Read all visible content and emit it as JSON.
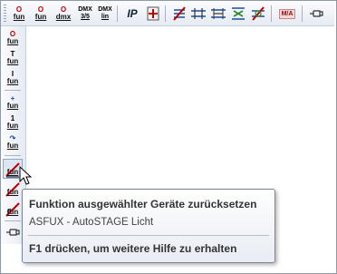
{
  "toolbar": {
    "buttons_top": [
      {
        "top": "O",
        "label": "fun"
      },
      {
        "top": "O",
        "label": "fun"
      },
      {
        "top": "O",
        "label": "dmx"
      },
      {
        "top": "DMX",
        "label": "3/5"
      },
      {
        "top": "DMX",
        "label": "lin"
      },
      {
        "label": "IP"
      }
    ],
    "vertical_buttons": [
      {
        "top": "O",
        "label": "fun"
      },
      {
        "top": "T",
        "label": "fun"
      },
      {
        "top": "I",
        "label": "fun"
      },
      {
        "top": "+",
        "label": "fun"
      },
      {
        "top": "1",
        "label": "fun"
      },
      {
        "top": "↷",
        "label": "fun"
      },
      {
        "top": "",
        "label": "fun"
      },
      {
        "top": "",
        "label": "fun"
      },
      {
        "top": "",
        "label": "fun"
      }
    ],
    "mia_label": "M/A"
  },
  "tooltip": {
    "title": "Funktion ausgewählter Geräte zurücksetzen",
    "subtitle": "ASFUX - AutoSTAGE Licht",
    "help": "F1 drücken, um weitere Hilfe zu erhalten"
  },
  "colors": {
    "accent_red": "#c00000",
    "toolbar_bg": "#e6eaf2",
    "border": "#8f98a8"
  }
}
